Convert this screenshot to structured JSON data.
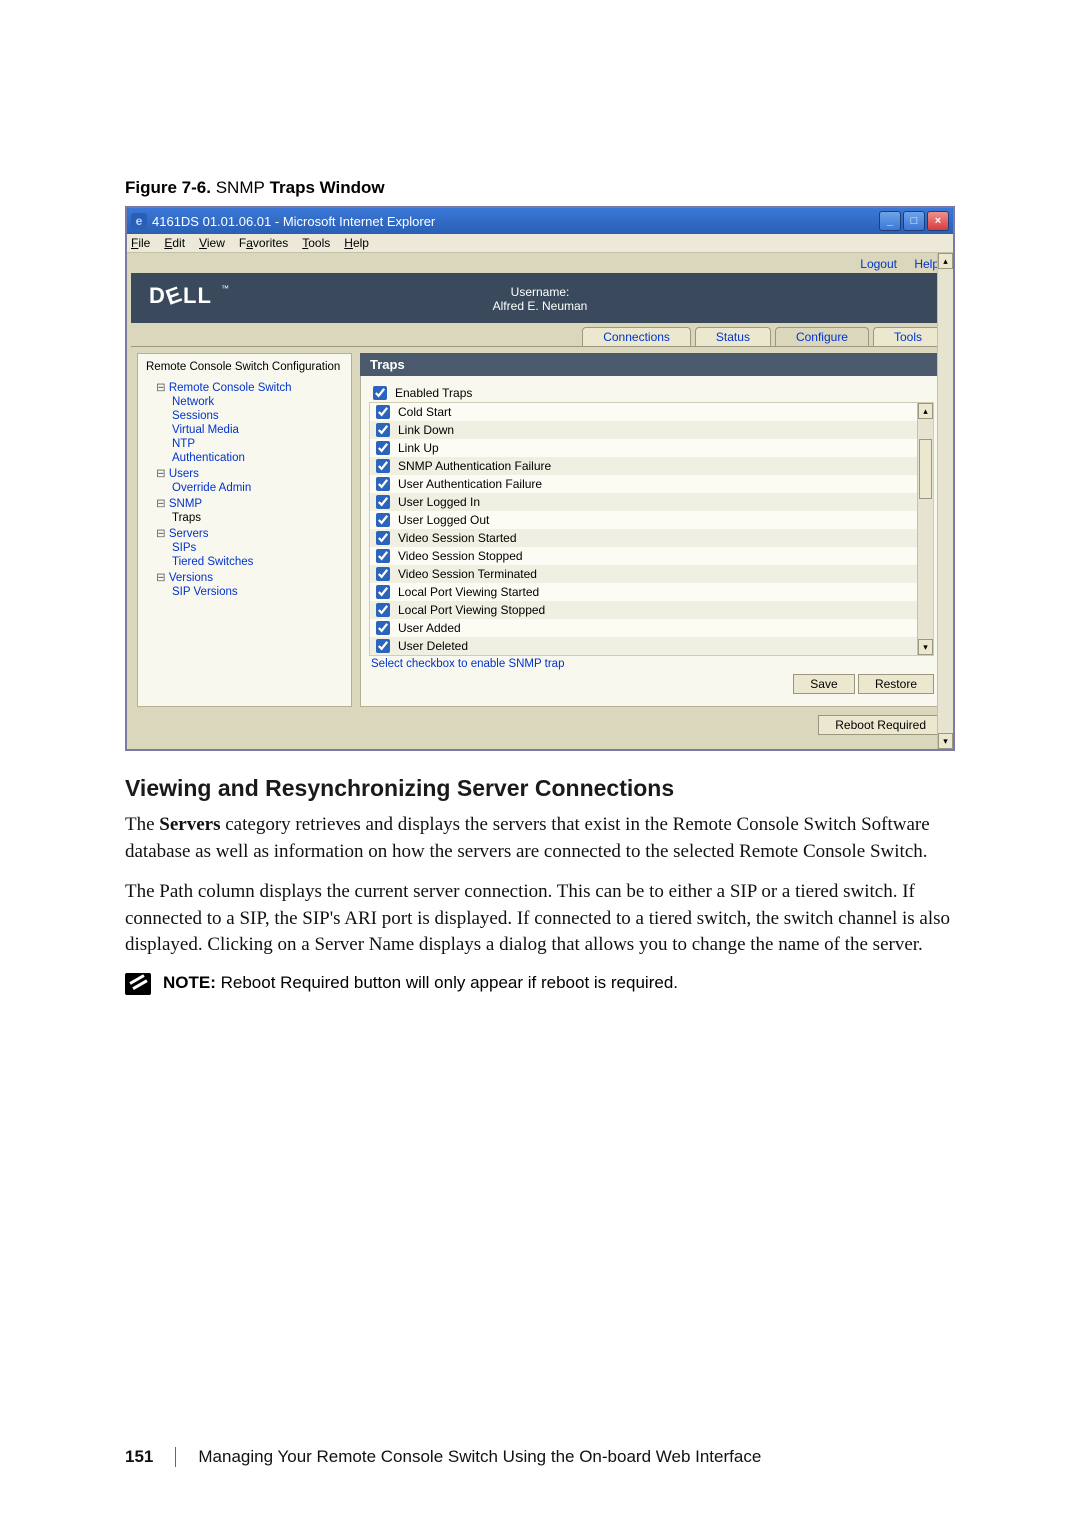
{
  "figure": {
    "label": "Figure 7-6.",
    "name": "SNMP",
    "suffix": "Traps Window"
  },
  "browser": {
    "title": "4161DS 01.01.06.01 - Microsoft Internet Explorer",
    "menu": {
      "file": "File",
      "edit": "Edit",
      "view": "View",
      "favorites": "Favorites",
      "tools": "Tools",
      "help": "Help"
    }
  },
  "toplinks": {
    "logout": "Logout",
    "help": "Help"
  },
  "banner": {
    "user_label": "Username:",
    "user_value": "Alfred E. Neuman",
    "logo_text": "DELL"
  },
  "tabs": {
    "connections": "Connections",
    "status": "Status",
    "configure": "Configure",
    "tools": "Tools"
  },
  "sidebar": {
    "title": "Remote Console Switch Configuration",
    "items": {
      "rcs": "Remote Console Switch",
      "network": "Network",
      "sessions": "Sessions",
      "vmedia": "Virtual Media",
      "ntp": "NTP",
      "auth": "Authentication",
      "users": "Users",
      "override": "Override Admin",
      "snmp": "SNMP",
      "traps": "Traps",
      "servers": "Servers",
      "sips": "SIPs",
      "tiered": "Tiered Switches",
      "versions": "Versions",
      "sipver": "SIP Versions"
    }
  },
  "pane": {
    "title": "Traps",
    "header": "Enabled Traps",
    "rows": [
      "Cold Start",
      "Link Down",
      "Link Up",
      "SNMP Authentication Failure",
      "User Authentication Failure",
      "User Logged In",
      "User Logged Out",
      "Video Session Started",
      "Video Session Stopped",
      "Video Session Terminated",
      "Local Port Viewing Started",
      "Local Port Viewing Stopped",
      "User Added",
      "User Deleted"
    ],
    "hint": "Select checkbox to enable SNMP trap",
    "save": "Save",
    "restore": "Restore",
    "reboot": "Reboot Required"
  },
  "section": {
    "heading": "Viewing and Resynchronizing Server Connections",
    "p1": "The Servers category retrieves and displays the servers that exist in the Remote Console Switch Software database as well as information on how the servers are connected to the selected Remote Console Switch.",
    "p2": "The Path column displays the current server connection. This can be to either a SIP or a tiered switch. If connected to a SIP, the SIP's ARI port is displayed. If connected to a tiered switch, the switch channel is also displayed. Clicking on a Server Name displays a dialog that allows you to change the name of the server."
  },
  "note": {
    "label": "NOTE:",
    "text": " Reboot Required button will only appear if reboot is required."
  },
  "footer": {
    "page": "151",
    "chapter": "Managing Your Remote Console Switch Using the On-board Web Interface"
  }
}
